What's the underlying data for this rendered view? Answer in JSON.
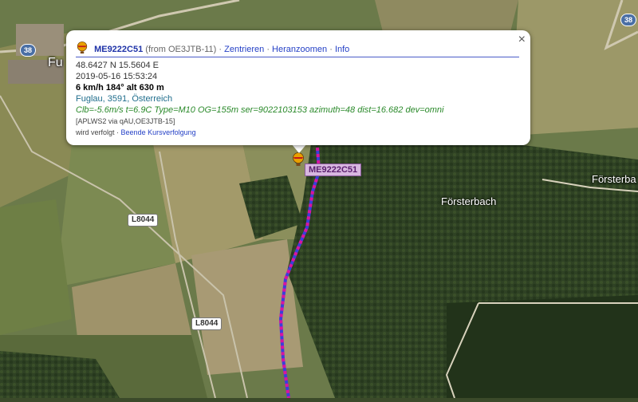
{
  "map": {
    "roads": {
      "road_38_left": "38",
      "road_38_right": "38",
      "l8044_top": "L8044",
      "l8044_bottom": "L8044"
    },
    "places": {
      "fuglau": "Fu",
      "forsterbach": "Försterbach",
      "forsterbach_right": "Försterba"
    },
    "track_colors": {
      "primary": "#d9149f",
      "secondary": "#3b3fd9"
    }
  },
  "marker": {
    "icon": "balloon-icon",
    "label": "ME9222C51"
  },
  "popup": {
    "callsign": "ME9222C51",
    "from_text": "(from OE3JTB-11)",
    "links": [
      "Zentrieren",
      "Heranzoomen",
      "Info"
    ],
    "coords": "48.6427 N 15.5604 E",
    "timestamp": "2019-05-16 15:53:24",
    "motion": "6 km/h 184° alt 630 m",
    "address": "Fuglau, 3591, Österreich",
    "comment": "Clb=-5.6m/s t=6.9C Type=M10 OG=155m ser=9022103153 azimuth=48 dist=16.682 dev=omni",
    "path": "[APLWS2 via qAU,OE3JTB-15]",
    "tracked_text": "wird verfolgt",
    "tracked_link": "Beende Kursverfolgung",
    "close": "×"
  }
}
